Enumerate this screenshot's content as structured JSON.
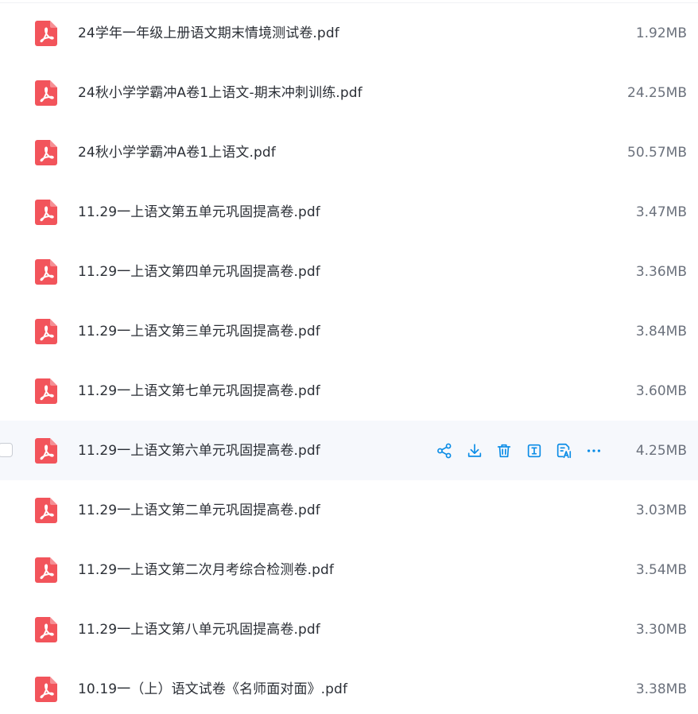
{
  "colors": {
    "pdf_icon": "#f2545b",
    "action_icon": "#0a8ce6",
    "hover_row": "#f6f8fc"
  },
  "files": [
    {
      "name": "24学年一年级上册语文期末情境测试卷.pdf",
      "size": "1.92MB"
    },
    {
      "name": "24秋小学学霸冲A卷1上语文-期末冲刺训练.pdf",
      "size": "24.25MB"
    },
    {
      "name": "24秋小学学霸冲A卷1上语文.pdf",
      "size": "50.57MB"
    },
    {
      "name": "11.29一上语文第五单元巩固提高卷.pdf",
      "size": "3.47MB"
    },
    {
      "name": "11.29一上语文第四单元巩固提高卷.pdf",
      "size": "3.36MB"
    },
    {
      "name": "11.29一上语文第三单元巩固提高卷.pdf",
      "size": "3.84MB"
    },
    {
      "name": "11.29一上语文第七单元巩固提高卷.pdf",
      "size": "3.60MB"
    },
    {
      "name": "11.29一上语文第六单元巩固提高卷.pdf",
      "size": "4.25MB",
      "hovered": true
    },
    {
      "name": "11.29一上语文第二单元巩固提高卷.pdf",
      "size": "3.03MB"
    },
    {
      "name": "11.29一上语文第二次月考综合检测卷.pdf",
      "size": "3.54MB"
    },
    {
      "name": "11.29一上语文第八单元巩固提高卷.pdf",
      "size": "3.30MB"
    },
    {
      "name": "10.19一（上）语文试卷《名师面对面》.pdf",
      "size": "3.38MB"
    }
  ],
  "row_actions": [
    {
      "name": "share",
      "icon": "share-icon"
    },
    {
      "name": "download",
      "icon": "download-icon"
    },
    {
      "name": "delete",
      "icon": "trash-icon"
    },
    {
      "name": "rename",
      "icon": "text-cursor-icon"
    },
    {
      "name": "ai-summary",
      "icon": "ai-document-icon"
    },
    {
      "name": "more",
      "icon": "more-horizontal-icon"
    }
  ]
}
